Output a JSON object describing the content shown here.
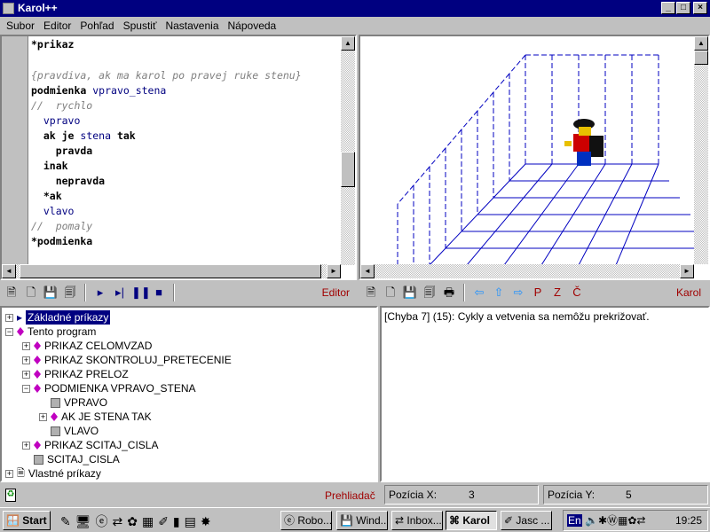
{
  "window": {
    "title": "Karol++"
  },
  "menu": [
    "Subor",
    "Editor",
    "Pohľad",
    "Spustiť",
    "Nastavenia",
    "Nápoveda"
  ],
  "editor": {
    "lines": [
      {
        "parts": [
          {
            "t": "*prikaz",
            "c": "kw"
          }
        ]
      },
      {
        "parts": []
      },
      {
        "parts": [
          {
            "t": "{pravdiva, ak ma karol po pravej ruke stenu}",
            "c": "cm"
          }
        ]
      },
      {
        "parts": [
          {
            "t": "podmienka ",
            "c": "kw"
          },
          {
            "t": "vpravo_stena",
            "c": "id"
          }
        ]
      },
      {
        "parts": [
          {
            "t": "//  rychlo",
            "c": "cm"
          }
        ]
      },
      {
        "parts": [
          {
            "t": "  vpravo",
            "c": "id"
          }
        ]
      },
      {
        "parts": [
          {
            "t": "  ak je ",
            "c": "kw"
          },
          {
            "t": "stena",
            "c": "id"
          },
          {
            "t": " tak",
            "c": "kw"
          }
        ]
      },
      {
        "parts": [
          {
            "t": "    pravda",
            "c": "kw"
          }
        ]
      },
      {
        "parts": [
          {
            "t": "  inak",
            "c": "kw"
          }
        ]
      },
      {
        "parts": [
          {
            "t": "    nepravda",
            "c": "kw"
          }
        ]
      },
      {
        "parts": [
          {
            "t": "  *ak",
            "c": "kw"
          }
        ]
      },
      {
        "parts": [
          {
            "t": "  vlavo",
            "c": "id"
          }
        ]
      },
      {
        "parts": [
          {
            "t": "//  pomaly",
            "c": "cm"
          }
        ]
      },
      {
        "parts": [
          {
            "t": "*podmienka",
            "c": "kw"
          }
        ]
      }
    ]
  },
  "editor_toolbar": {
    "label": "Editor"
  },
  "karol_toolbar": {
    "label": "Karol",
    "p": "P",
    "z": "Z",
    "c": "Č"
  },
  "tree": [
    {
      "label": "Základné príkazy",
      "level": 0,
      "exp": "+",
      "icon": "arrow",
      "selected": true
    },
    {
      "label": "Tento program",
      "level": 0,
      "exp": "-",
      "icon": "diamond"
    },
    {
      "label": "PRIKAZ CELOMVZAD",
      "level": 1,
      "exp": "+",
      "icon": "diamond"
    },
    {
      "label": "PRIKAZ SKONTROLUJ_PRETECENIE",
      "level": 1,
      "exp": "+",
      "icon": "diamond"
    },
    {
      "label": "PRIKAZ PRELOZ",
      "level": 1,
      "exp": "+",
      "icon": "diamond"
    },
    {
      "label": "PODMIENKA VPRAVO_STENA",
      "level": 1,
      "exp": "-",
      "icon": "diamond"
    },
    {
      "label": "VPRAVO",
      "level": 2,
      "exp": "",
      "icon": "cube"
    },
    {
      "label": "AK JE STENA TAK",
      "level": 2,
      "exp": "+",
      "icon": "diamond"
    },
    {
      "label": "VLAVO",
      "level": 2,
      "exp": "",
      "icon": "cube"
    },
    {
      "label": "PRIKAZ SCITAJ_CISLA",
      "level": 1,
      "exp": "+",
      "icon": "diamond"
    },
    {
      "label": "SCITAJ_CISLA",
      "level": 1,
      "exp": "",
      "icon": "cube"
    },
    {
      "label": "Vlastné príkazy",
      "level": 0,
      "exp": "+",
      "icon": "doc"
    }
  ],
  "messages": [
    "[Chyba 7] (15): Cykly a vetvenia sa nemôžu prekrižovať."
  ],
  "status": {
    "browser_label": "Prehliadač",
    "pos_x_label": "Pozícia X:",
    "pos_x": "3",
    "pos_y_label": "Pozícia Y:",
    "pos_y": "5"
  },
  "taskbar": {
    "start": "Start",
    "tasks": [
      "Robo...",
      "Wind...",
      "Inbox...",
      "Karol",
      "Jasc ..."
    ],
    "active": "Karol",
    "lang": "En",
    "clock": "19:25"
  }
}
